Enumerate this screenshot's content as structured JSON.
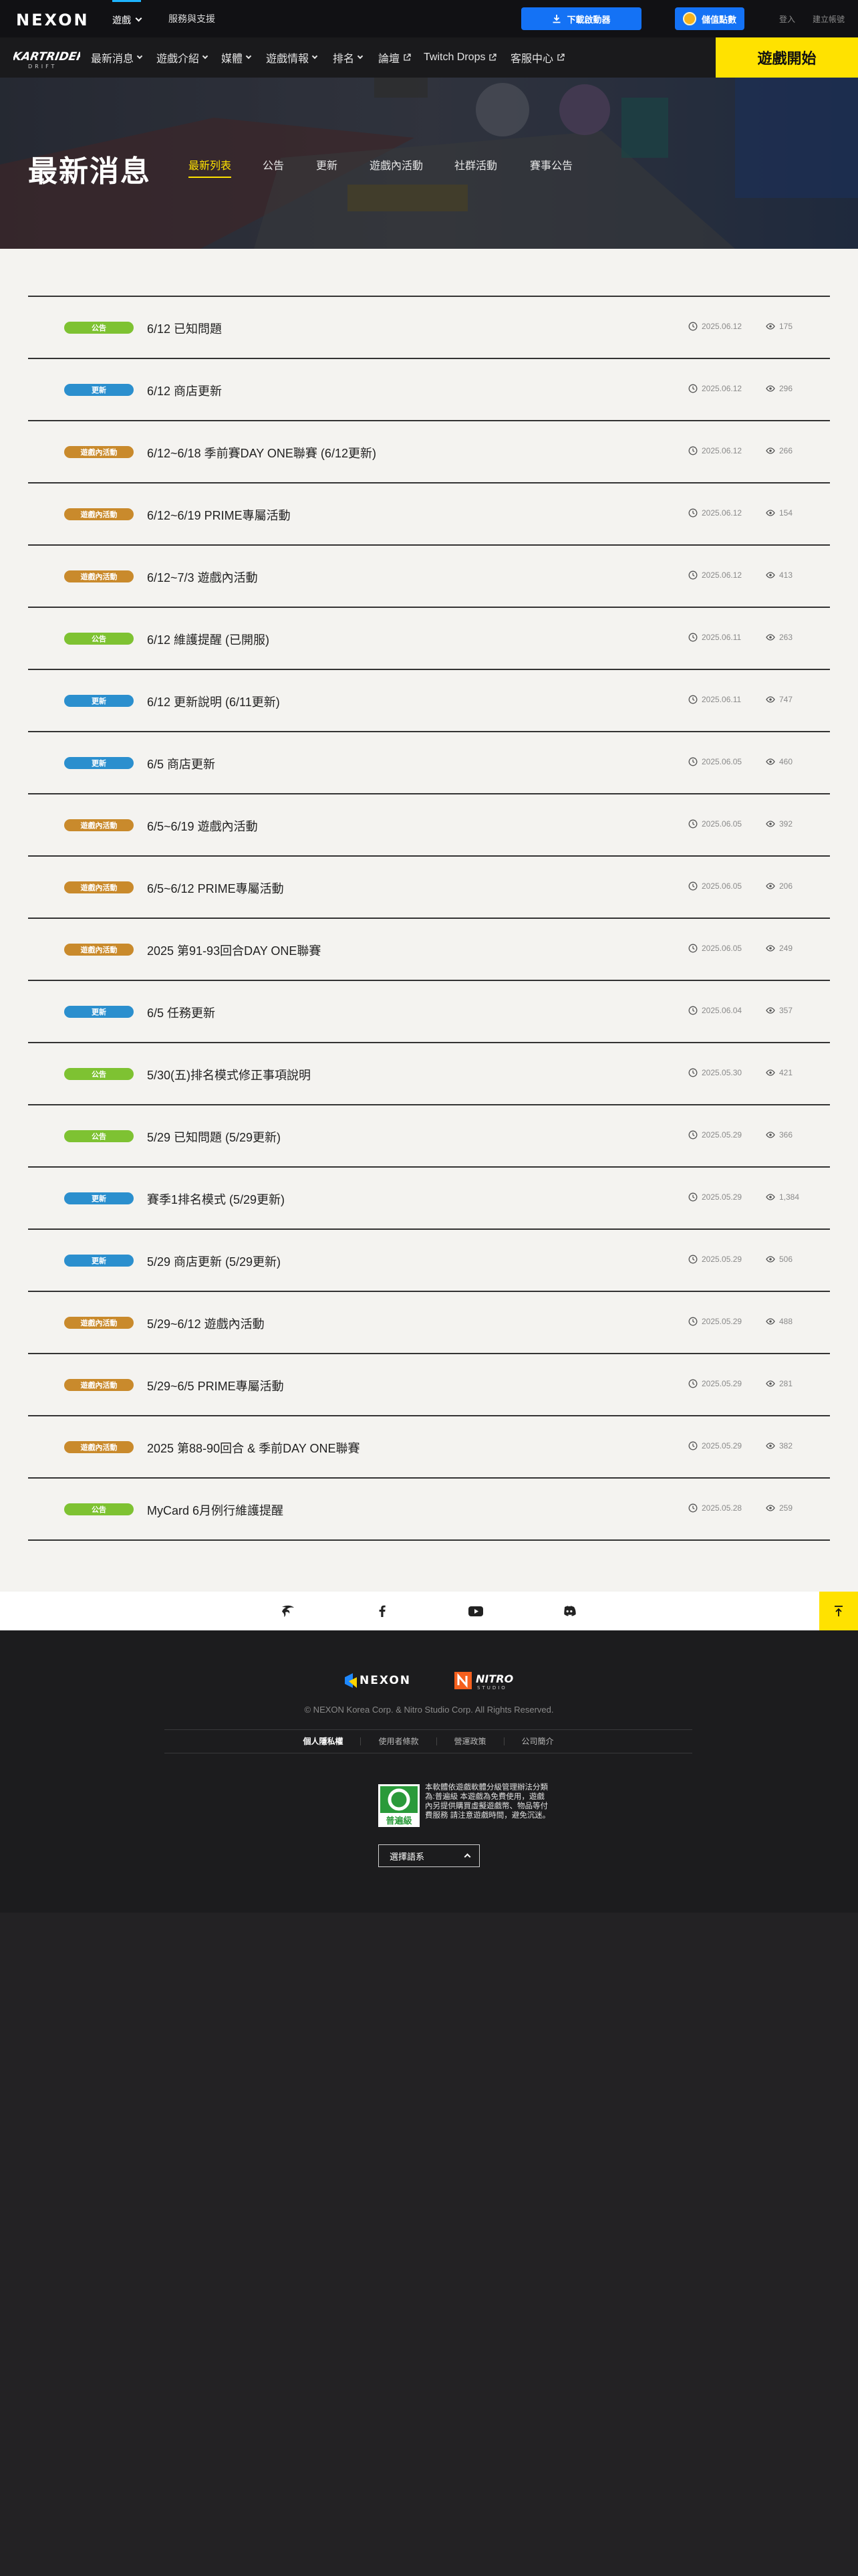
{
  "topbar": {
    "logo": "NEXON",
    "tabs": [
      "遊戲",
      "服務與支援"
    ],
    "download_label": "下載啟動器",
    "cash_label": "儲值點數",
    "login_label": "登入",
    "signup_label": "建立帳號"
  },
  "gamenav": {
    "logo": "KARTRIDER",
    "logo_sub": "DRIFT",
    "items": [
      "最新消息",
      "遊戲介紹",
      "媒體",
      "遊戲情報",
      "排名",
      "論壇",
      "Twitch Drops",
      "客服中心"
    ],
    "start_label": "遊戲開始"
  },
  "hero": {
    "title": "最新消息",
    "tabs": [
      "最新列表",
      "公告",
      "更新",
      "遊戲內活動",
      "社群活動",
      "賽事公告"
    ]
  },
  "colors": {
    "公告": "#7ec232",
    "更新": "#2b8fce",
    "遊戲內活動": "#c98a2c",
    "accent": "#ffe200",
    "blue": "#1472f5"
  },
  "news": [
    {
      "cat": "公告",
      "title": "6/12 已知問題",
      "date": "2025.06.12",
      "views": "175"
    },
    {
      "cat": "更新",
      "title": "6/12 商店更新",
      "date": "2025.06.12",
      "views": "296"
    },
    {
      "cat": "遊戲內活動",
      "title": "6/12~6/18 季前賽DAY ONE聯賽 (6/12更新)",
      "date": "2025.06.12",
      "views": "266"
    },
    {
      "cat": "遊戲內活動",
      "title": "6/12~6/19 PRIME專屬活動",
      "date": "2025.06.12",
      "views": "154"
    },
    {
      "cat": "遊戲內活動",
      "title": "6/12~7/3 遊戲內活動",
      "date": "2025.06.12",
      "views": "413"
    },
    {
      "cat": "公告",
      "title": "6/12 維護提醒 (已開服)",
      "date": "2025.06.11",
      "views": "263"
    },
    {
      "cat": "更新",
      "title": "6/12 更新說明 (6/11更新)",
      "date": "2025.06.11",
      "views": "747"
    },
    {
      "cat": "更新",
      "title": "6/5 商店更新",
      "date": "2025.06.05",
      "views": "460"
    },
    {
      "cat": "遊戲內活動",
      "title": "6/5~6/19 遊戲內活動",
      "date": "2025.06.05",
      "views": "392"
    },
    {
      "cat": "遊戲內活動",
      "title": "6/5~6/12 PRIME專屬活動",
      "date": "2025.06.05",
      "views": "206"
    },
    {
      "cat": "遊戲內活動",
      "title": "2025 第91-93回合DAY ONE聯賽",
      "date": "2025.06.05",
      "views": "249"
    },
    {
      "cat": "更新",
      "title": "6/5 任務更新",
      "date": "2025.06.04",
      "views": "357"
    },
    {
      "cat": "公告",
      "title": "5/30(五)排名模式修正事項說明",
      "date": "2025.05.30",
      "views": "421"
    },
    {
      "cat": "公告",
      "title": "5/29 已知問題 (5/29更新)",
      "date": "2025.05.29",
      "views": "366"
    },
    {
      "cat": "更新",
      "title": "賽季1排名模式 (5/29更新)",
      "date": "2025.05.29",
      "views": "1,384"
    },
    {
      "cat": "更新",
      "title": "5/29 商店更新 (5/29更新)",
      "date": "2025.05.29",
      "views": "506"
    },
    {
      "cat": "遊戲內活動",
      "title": "5/29~6/12 遊戲內活動",
      "date": "2025.05.29",
      "views": "488"
    },
    {
      "cat": "遊戲內活動",
      "title": "5/29~6/5 PRIME專屬活動",
      "date": "2025.05.29",
      "views": "281"
    },
    {
      "cat": "遊戲內活動",
      "title": "2025 第88-90回合 & 季前DAY ONE聯賽",
      "date": "2025.05.29",
      "views": "382"
    },
    {
      "cat": "公告",
      "title": "MyCard 6月例行維護提醒",
      "date": "2025.05.28",
      "views": "259"
    }
  ],
  "footer": {
    "nexon_logo": "NEXON",
    "nitro_logo": "NITRO",
    "nitro_sub": "STUDIO",
    "copyright": "© NEXON Korea Corp. & Nitro Studio Corp. All Rights Reserved.",
    "links": [
      "個人隱私權",
      "使用者條款",
      "營運政策",
      "公司簡介"
    ],
    "rating_label": "普遍級",
    "rating_text": "本軟體依遊戲軟體分級管理辦法分類為:普遍級 本遊戲為免費使用，遊戲內另提供購買虛擬遊戲幣、物品等付費服務 請注意遊戲時間，避免沉迷。",
    "lang_label": "選擇語系"
  }
}
